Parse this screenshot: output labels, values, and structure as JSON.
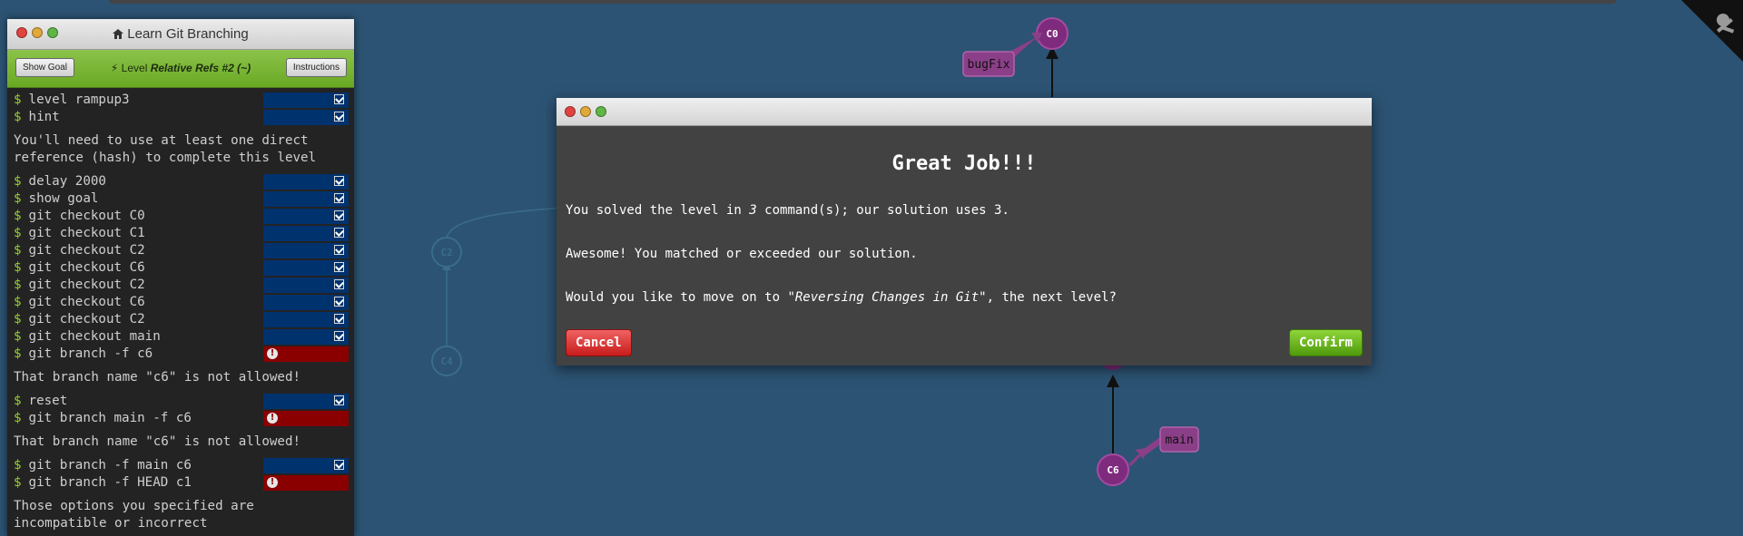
{
  "left_panel": {
    "title": "Learn Git Branching",
    "level_prefix": "Level",
    "level_name": "Relative Refs #2 (~)",
    "show_goal_label": "Show Goal",
    "instructions_label": "Instructions"
  },
  "terminal": {
    "prompt": "$",
    "entries": [
      {
        "type": "cmd",
        "text": "level rampup3",
        "status": "ok"
      },
      {
        "type": "cmd",
        "text": "hint",
        "status": "ok"
      },
      {
        "type": "msg",
        "text": "You'll need to use at least one direct\nreference (hash) to complete this level"
      },
      {
        "type": "cmd",
        "text": "delay 2000",
        "status": "ok"
      },
      {
        "type": "cmd",
        "text": "show goal",
        "status": "ok"
      },
      {
        "type": "cmd",
        "text": "git checkout C0",
        "status": "ok"
      },
      {
        "type": "cmd",
        "text": "git checkout C1",
        "status": "ok"
      },
      {
        "type": "cmd",
        "text": "git checkout C2",
        "status": "ok"
      },
      {
        "type": "cmd",
        "text": "git checkout C6",
        "status": "ok"
      },
      {
        "type": "cmd",
        "text": "git checkout C2",
        "status": "ok"
      },
      {
        "type": "cmd",
        "text": "git checkout C6",
        "status": "ok"
      },
      {
        "type": "cmd",
        "text": "git checkout C2",
        "status": "ok"
      },
      {
        "type": "cmd",
        "text": "git checkout main",
        "status": "ok"
      },
      {
        "type": "cmd",
        "text": "git branch -f c6",
        "status": "err"
      },
      {
        "type": "msg",
        "text": "That branch name \"c6\" is not allowed!"
      },
      {
        "type": "cmd",
        "text": "reset",
        "status": "ok"
      },
      {
        "type": "cmd",
        "text": "git branch main -f c6",
        "status": "err"
      },
      {
        "type": "msg",
        "text": "That branch name \"c6\" is not allowed!"
      },
      {
        "type": "cmd",
        "text": "git branch -f main c6",
        "status": "ok"
      },
      {
        "type": "cmd",
        "text": "git branch -f HEAD c1",
        "status": "err"
      },
      {
        "type": "msg",
        "text": "Those options you specified are\nincompatible or incorrect"
      }
    ]
  },
  "graph": {
    "nodes": {
      "c0": "C0",
      "c2_ghost": "C2",
      "c4_ghost": "C4",
      "c6": "C6"
    },
    "branches": {
      "bugfix": "bugFix",
      "main": "main"
    },
    "colors": {
      "background": "#2c5373",
      "commit": "#7f2b7d",
      "branch": "#8b3f88",
      "ghost": "#3a6d89"
    }
  },
  "modal": {
    "heading": "Great Job!!!",
    "line1_a": "You solved the level in ",
    "line1_count": "3",
    "line1_b": " command(s); our solution uses 3.",
    "line2": "Awesome! You matched or exceeded our solution.",
    "line3_a": "Would you like to move on to ",
    "line3_level": "\"Reversing Changes in Git\"",
    "line3_b": ", the next level?",
    "cancel_label": "Cancel",
    "confirm_label": "Confirm"
  }
}
